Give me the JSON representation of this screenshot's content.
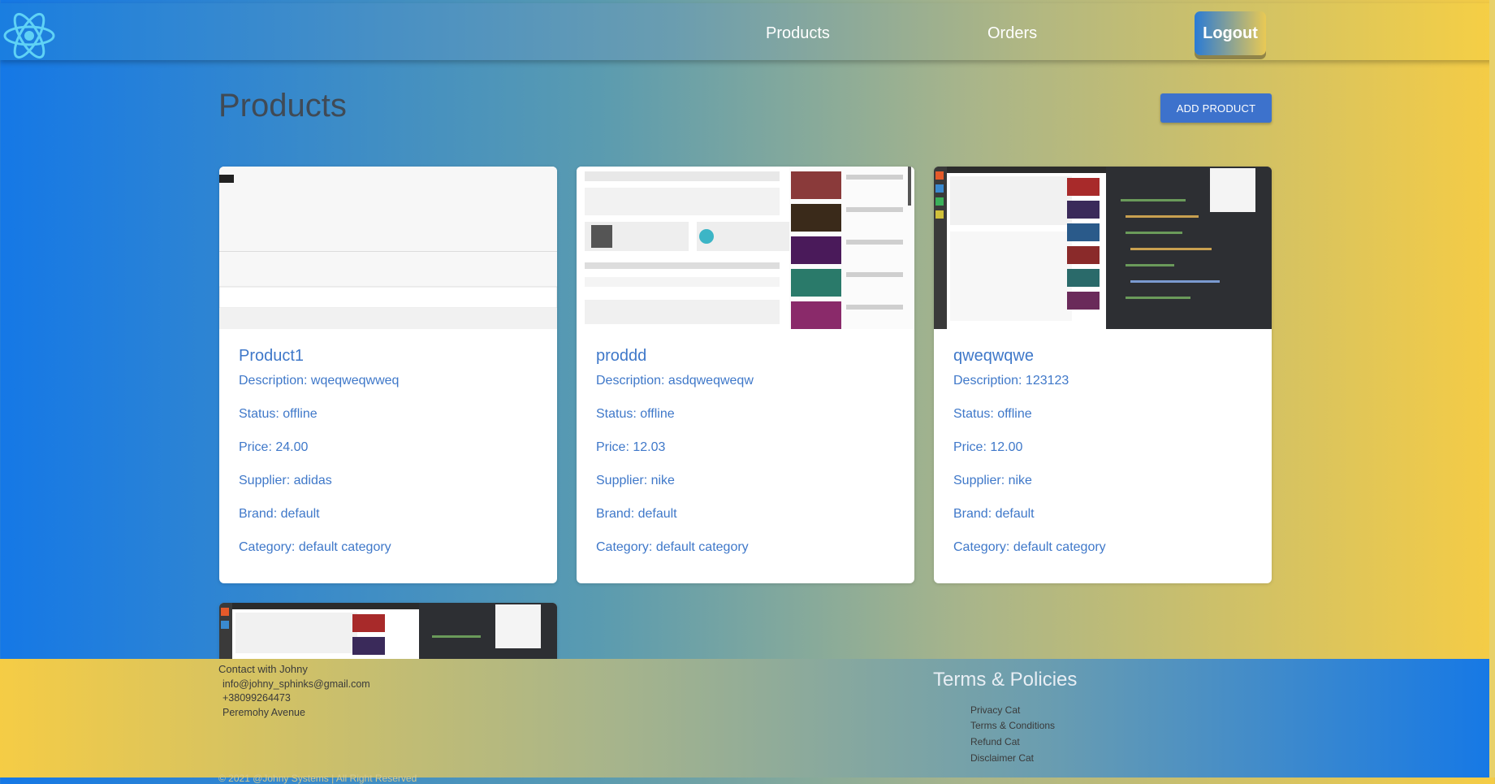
{
  "nav": {
    "logo_icon": "react-atom-icon",
    "products_label": "Products",
    "orders_label": "Orders",
    "logout_label": "Logout"
  },
  "page": {
    "title": "Products",
    "add_label": "ADD PRODUCT"
  },
  "products": [
    {
      "name": "Product1",
      "description": "Description: wqeqweqwweq",
      "status": "Status: offline",
      "price": "Price: 24.00",
      "supplier": "Supplier: adidas",
      "brand": "Brand: default",
      "category": "Category: default category"
    },
    {
      "name": "proddd",
      "description": "Description: asdqweqweqw",
      "status": "Status: offline",
      "price": "Price: 12.03",
      "supplier": "Supplier: nike",
      "brand": "Brand: default",
      "category": "Category: default category"
    },
    {
      "name": "qweqwqwe",
      "description": "Description: 123123",
      "status": "Status: offline",
      "price": "Price: 12.00",
      "supplier": "Supplier: nike",
      "brand": "Brand: default",
      "category": "Category: default category"
    }
  ],
  "footer": {
    "contact_title": "Contact with Johny",
    "email": "info@johny_sphinks@gmail.com",
    "phone": "+38099264473",
    "address": "Peremohy Avenue",
    "terms_title": "Terms & Policies",
    "links": [
      "Privacy Cat",
      "Terms & Conditions",
      "Refund Cat",
      "Disclaimer Cat"
    ],
    "copyright": "© 2021 @Johny Systems | All Right Reserved"
  },
  "colors": {
    "accent": "#3f78c9",
    "add_button": "#3d72cc",
    "gradient_blue": "#1578e6",
    "gradient_yellow": "#f5cc45"
  }
}
